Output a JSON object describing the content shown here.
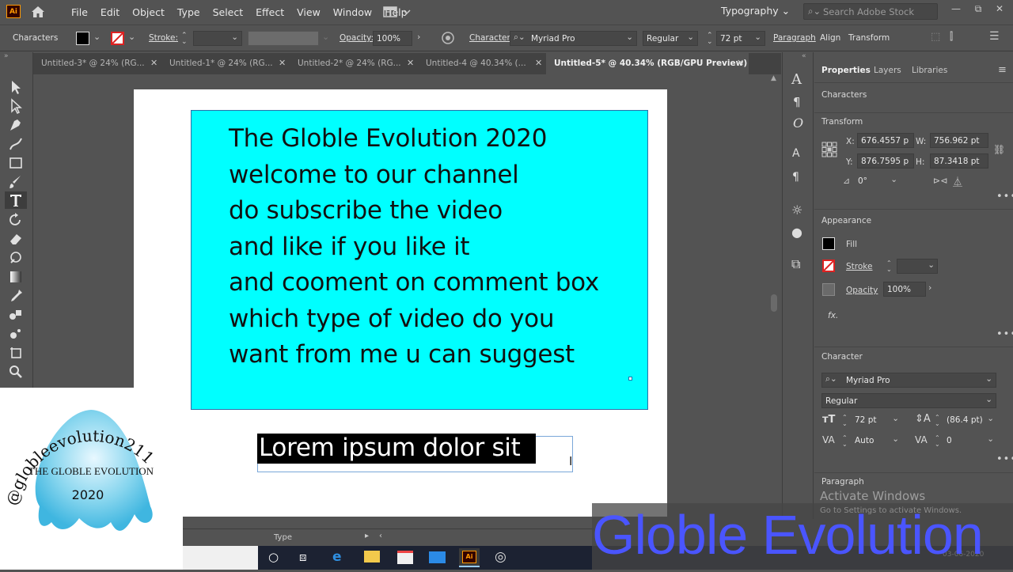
{
  "app": {
    "logo": "Ai"
  },
  "menu": [
    "File",
    "Edit",
    "Object",
    "Type",
    "Select",
    "Effect",
    "View",
    "Window",
    "Help"
  ],
  "workspace": "Typography",
  "search_placeholder": "Search Adobe Stock",
  "control": {
    "label": "Characters",
    "stroke_label": "Stroke:",
    "opacity_label": "Opacity:",
    "opacity_value": "100%",
    "character_label": "Character:",
    "font": "Myriad Pro",
    "style": "Regular",
    "size": "72 pt",
    "paragraph": "Paragraph",
    "align": "Align",
    "transform": "Transform"
  },
  "tabs": [
    {
      "label": "Untitled-3* @ 24% (RG..."
    },
    {
      "label": "Untitled-1* @ 24% (RG..."
    },
    {
      "label": "Untitled-2* @ 24% (RG..."
    },
    {
      "label": "Untitled-4 @ 40.34% (..."
    },
    {
      "label": "Untitled-5* @ 40.34% (RGB/GPU Preview)"
    }
  ],
  "artboard": {
    "lines": [
      "The Globle Evolution 2020",
      "welcome to our channel",
      "do subscribe the video",
      "and like if you like it",
      "and cooment on comment box",
      "which type of video do you",
      "want from me u can suggest"
    ],
    "selected_text": "Lorem ipsum dolor sit"
  },
  "properties": {
    "tabs": [
      "Properties",
      "Layers",
      "Libraries"
    ],
    "selection": "Characters",
    "transform_title": "Transform",
    "x_label": "X:",
    "x": "676.4557 p",
    "y_label": "Y:",
    "y": "876.7595 p",
    "w_label": "W:",
    "w": "756.962 pt",
    "h_label": "H:",
    "h": "87.3418 pt",
    "angle": "0°",
    "appearance_title": "Appearance",
    "fill": "Fill",
    "stroke": "Stroke",
    "opacity": "Opacity",
    "opacity_value": "100%",
    "fx": "fx.",
    "character_title": "Character",
    "font": "Myriad Pro",
    "style": "Regular",
    "size": "72 pt",
    "leading": "(86.4 pt)",
    "kerning": "Auto",
    "tracking": "0",
    "paragraph_title": "Paragraph"
  },
  "status": {
    "tool": "Type"
  },
  "watermark": {
    "ring_text": "@globleevolution211",
    "inner_title": "THE GLOBLE EVOLUTION",
    "year": "2020"
  },
  "overlay": {
    "activate": "Activate Windows",
    "activate_sub": "Go to Settings to activate Windows.",
    "channel": "Globle Evolution",
    "date": "03-06-2020"
  },
  "colors": {
    "cyan": "#00ffff",
    "accent": "#4a55ff",
    "ui_bg": "#535353"
  }
}
